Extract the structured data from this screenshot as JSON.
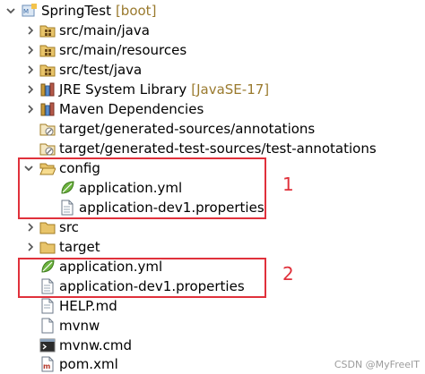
{
  "tree": {
    "project": {
      "name": "SpringTest",
      "decoration": "[boot]"
    },
    "items": [
      {
        "label": "src/main/java"
      },
      {
        "label": "src/main/resources"
      },
      {
        "label": "src/test/java"
      },
      {
        "label": "JRE System Library",
        "decoration": "[JavaSE-17]"
      },
      {
        "label": "Maven Dependencies"
      },
      {
        "label": "target/generated-sources/annotations"
      },
      {
        "label": "target/generated-test-sources/test-annotations"
      },
      {
        "label": "config"
      },
      {
        "label": "application.yml"
      },
      {
        "label": "application-dev1.properties"
      },
      {
        "label": "src"
      },
      {
        "label": "target"
      },
      {
        "label": "application.yml"
      },
      {
        "label": "application-dev1.properties"
      },
      {
        "label": "HELP.md"
      },
      {
        "label": "mvnw"
      },
      {
        "label": "mvnw.cmd"
      },
      {
        "label": "pom.xml"
      }
    ]
  },
  "annotations": {
    "box1": "1",
    "box2": "2"
  },
  "watermark": "CSDN @MyFreeIT",
  "colors": {
    "annotation": "#e0313b",
    "folder": "#e8c46a",
    "decoration": "#9a7a2e"
  }
}
